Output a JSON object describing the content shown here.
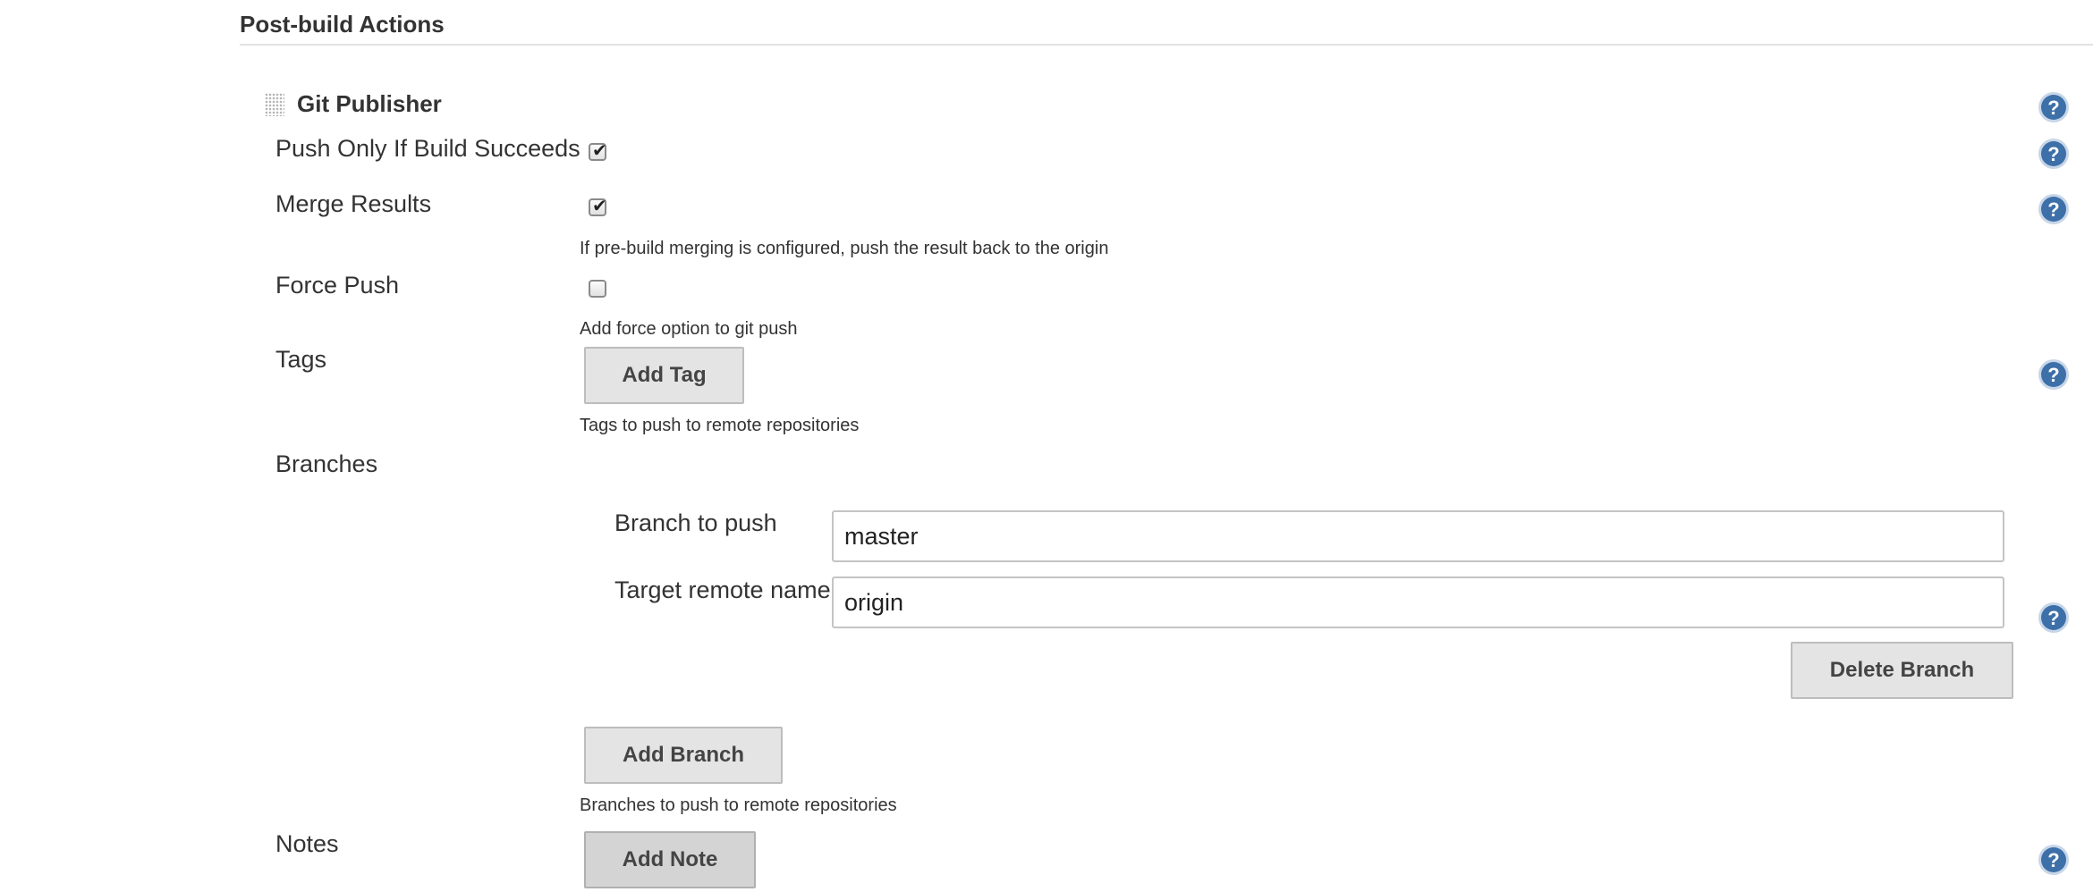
{
  "section": {
    "title": "Post-build Actions"
  },
  "publisher": {
    "title": "Git Publisher",
    "drag_icon": "drag-handle-icon",
    "help_icon": "question-mark-icon"
  },
  "fields": {
    "push_only_if_success": {
      "label": "Push Only If Build Succeeds",
      "checked": true
    },
    "merge_results": {
      "label": "Merge Results",
      "checked": true,
      "help": "If pre-build merging is configured, push the result back to the origin"
    },
    "force_push": {
      "label": "Force Push",
      "checked": false,
      "help": "Add force option to git push"
    },
    "tags": {
      "label": "Tags",
      "button": "Add Tag",
      "help": "Tags to push to remote repositories"
    },
    "branches": {
      "label": "Branches",
      "branch_to_push_label": "Branch to push",
      "branch_to_push_value": "master",
      "target_remote_label": "Target remote name",
      "target_remote_value": "origin",
      "delete_button": "Delete Branch",
      "add_button": "Add Branch",
      "help": "Branches to push to remote repositories"
    },
    "notes": {
      "label": "Notes",
      "button": "Add Note"
    }
  },
  "colors": {
    "help_icon_fill": "#3d6fa8",
    "help_icon_ring": "#c7d6e8",
    "button_bg": "#e4e4e4",
    "text": "#333333"
  }
}
